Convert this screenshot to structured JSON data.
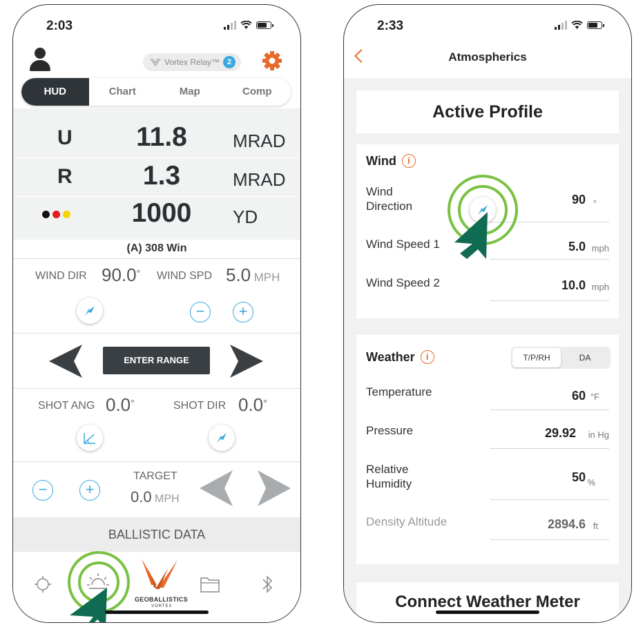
{
  "phone1": {
    "status": {
      "time": "2:03"
    },
    "header": {
      "relay_label": "Vortex Relay™",
      "relay_count": "2"
    },
    "tabs": [
      {
        "label": "HUD",
        "active": true
      },
      {
        "label": "Chart",
        "active": false
      },
      {
        "label": "Map",
        "active": false
      },
      {
        "label": "Comp",
        "active": false
      }
    ],
    "readouts": [
      {
        "label": "U",
        "value": "11.8",
        "unit": "MRAD"
      },
      {
        "label": "R",
        "value": "1.3",
        "unit": "MRAD"
      },
      {
        "label": "",
        "value": "1000",
        "unit": "YD"
      }
    ],
    "dot_colors": [
      "#111111",
      "#e21b1b",
      "#f2d600"
    ],
    "profile": "(A) 308 Win",
    "wind": {
      "dir_label": "WIND DIR",
      "dir_value": "90.0",
      "dir_unit": "°",
      "spd_label": "WIND SPD",
      "spd_value": "5.0",
      "spd_unit": "MPH"
    },
    "enter_range": "ENTER RANGE",
    "shot": {
      "ang_label": "SHOT ANG",
      "ang_value": "0.0",
      "ang_unit": "°",
      "dir_label": "SHOT DIR",
      "dir_value": "0.0",
      "dir_unit": "°"
    },
    "target": {
      "label": "TARGET",
      "value": "0.0",
      "unit": "MPH"
    },
    "ballistic_data": "BALLISTIC DATA",
    "logo_text": "GEOBALLISTICS",
    "logo_sub": "VORTEX",
    "minus": "−",
    "plus": "+"
  },
  "phone2": {
    "status": {
      "time": "2:33"
    },
    "title": "Atmospherics",
    "active_profile": "Active Profile",
    "wind": {
      "heading": "Wind",
      "info": "i",
      "rows": [
        {
          "label": "Wind\nDirection",
          "value": "90",
          "unit": "°"
        },
        {
          "label": "Wind Speed 1",
          "value": "5.0",
          "unit": "mph"
        },
        {
          "label": "Wind Speed 2",
          "value": "10.0",
          "unit": "mph"
        }
      ]
    },
    "weather": {
      "heading": "Weather",
      "info": "i",
      "segments": [
        {
          "label": "T/P/RH",
          "active": true
        },
        {
          "label": "DA",
          "active": false
        }
      ],
      "rows": [
        {
          "label": "Temperature",
          "value": "60",
          "unit": "°F"
        },
        {
          "label": "Pressure",
          "value": "29.92",
          "unit": "in Hg"
        },
        {
          "label": "Relative\nHumidity",
          "value": "50",
          "unit": "%"
        },
        {
          "label": "Density Altitude",
          "value": "2894.6",
          "unit": "ft"
        }
      ]
    },
    "connect": "Connect Weather Meter"
  },
  "colors": {
    "accent_orange": "#e8692a",
    "accent_blue": "#3aa9e0",
    "highlight_green": "#7ac143",
    "cursor_teal": "#0f6b52",
    "dark": "#2f3439"
  }
}
